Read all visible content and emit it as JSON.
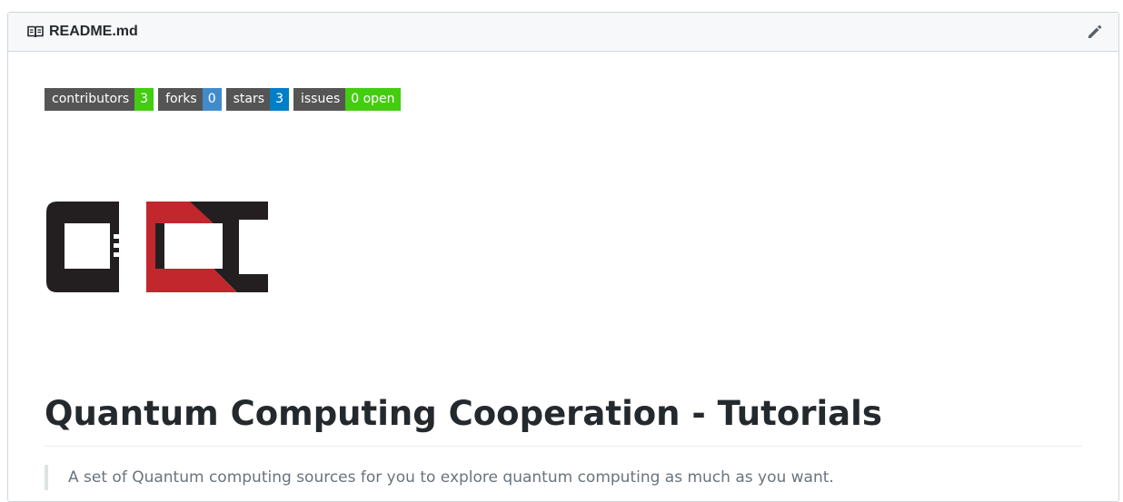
{
  "readme": {
    "filename": "README.md",
    "edit_icon": "pencil-icon",
    "file_icon": "book-icon"
  },
  "badges": [
    {
      "label": "contributors",
      "value": "3",
      "color": "#4c1"
    },
    {
      "label": "forks",
      "value": "0",
      "color": "#428bca"
    },
    {
      "label": "stars",
      "value": "3",
      "color": "#007ec6"
    },
    {
      "label": "issues",
      "value": "0 open",
      "color": "#4c1"
    }
  ],
  "logo": {
    "text": "QCC",
    "colors": {
      "dark": "#231f20",
      "red": "#c1272d"
    }
  },
  "content": {
    "title": "Quantum Computing Cooperation - Tutorials",
    "intro": "A set of Quantum computing sources for you to explore quantum computing as much as you want."
  }
}
